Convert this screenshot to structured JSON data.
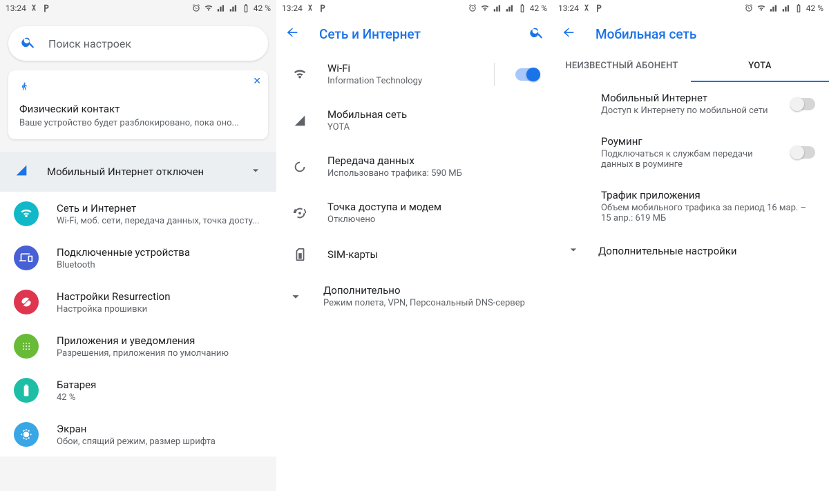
{
  "status": {
    "time": "13:24",
    "battery": "42 %"
  },
  "screen1": {
    "search_placeholder": "Поиск настроек",
    "card": {
      "title": "Физический контакт",
      "subtitle": "Ваше устройство будет разблокировано, пока оно..."
    },
    "banner": {
      "title": "Мобильный Интернет отключен"
    },
    "items": [
      {
        "title": "Сеть и Интернет",
        "subtitle": "Wi-Fi, моб. сети, передача данных, точка досту...",
        "color": "#11b8c7"
      },
      {
        "title": "Подключенные устройства",
        "subtitle": "Bluetooth",
        "color": "#4760d6"
      },
      {
        "title": "Настройки Resurrection",
        "subtitle": "Настройка прошивки",
        "color": "#e0354e"
      },
      {
        "title": "Приложения и уведомления",
        "subtitle": "Разрешения, приложения по умолчанию",
        "color": "#68bb36"
      },
      {
        "title": "Батарея",
        "subtitle": "42 %",
        "color": "#1cbfa6"
      },
      {
        "title": "Экран",
        "subtitle": "Обои, спящий режим, размер шрифта",
        "color": "#39a6e6"
      }
    ]
  },
  "screen2": {
    "title": "Сеть и Интернет",
    "rows": [
      {
        "title": "Wi-Fi",
        "subtitle": "Information Technology",
        "toggle": "on"
      },
      {
        "title": "Мобильная сеть",
        "subtitle": "YOTA"
      },
      {
        "title": "Передача данных",
        "subtitle": "Использовано трафика: 590 МБ"
      },
      {
        "title": "Точка доступа и модем",
        "subtitle": "Отключено"
      },
      {
        "title": "SIM-карты",
        "subtitle": ""
      },
      {
        "title": "Дополнительно",
        "subtitle": "Режим полета, VPN, Персональный DNS-сервер"
      }
    ]
  },
  "screen3": {
    "title": "Мобильная сеть",
    "tabs": [
      {
        "label": "НЕИЗВЕСТНЫЙ АБОНЕНТ",
        "active": false
      },
      {
        "label": "YOTA",
        "active": true
      }
    ],
    "items": [
      {
        "title": "Мобильный Интернет",
        "subtitle": "Доступ к Интернету по мобильной сети",
        "toggle": "off"
      },
      {
        "title": "Роуминг",
        "subtitle": "Подключаться к службам передачи данных в роуминге",
        "toggle": "off"
      },
      {
        "title": "Трафик приложения",
        "subtitle": "Объем мобильного трафика за период 16 мар. – 15 апр.: 619 МБ"
      }
    ],
    "expand": "Дополнительные настройки"
  }
}
